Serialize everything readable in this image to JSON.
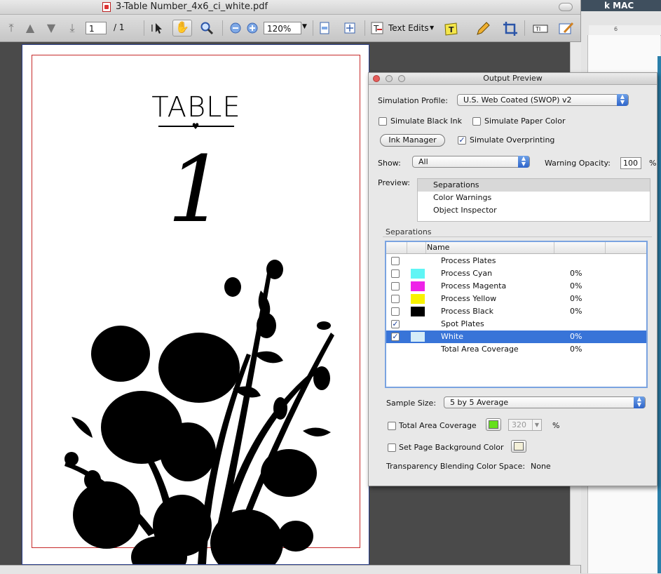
{
  "background_window": {
    "title": "k MAC",
    "ruler_mark": "6"
  },
  "document_window": {
    "title": "3-Table Number_4x6_ci_white.pdf",
    "toolbar": {
      "page_number": "1",
      "page_total": "/  1",
      "zoom": "120%",
      "text_edits_label": "Text Edits",
      "icons": [
        "first-page-icon",
        "prev-page-icon",
        "next-page-icon",
        "last-page-icon",
        "select-tool-icon",
        "hand-tool-icon",
        "zoom-tool-icon",
        "zoom-out-icon",
        "zoom-in-icon",
        "fit-width-icon",
        "full-screen-icon",
        "text-edits-icon",
        "sticky-note-icon",
        "pencil-icon",
        "crop-icon",
        "text-field-icon",
        "sign-icon"
      ]
    },
    "page": {
      "heading": "TABLE",
      "number": "1"
    }
  },
  "output_preview": {
    "title": "Output Preview",
    "simulation_profile_label": "Simulation Profile:",
    "simulation_profile_value": "U.S. Web Coated (SWOP) v2",
    "simulate_black_ink": {
      "label": "Simulate Black Ink",
      "checked": false
    },
    "simulate_paper_color": {
      "label": "Simulate Paper Color",
      "checked": false
    },
    "ink_manager_label": "Ink Manager",
    "simulate_overprinting": {
      "label": "Simulate Overprinting",
      "checked": true
    },
    "show_label": "Show:",
    "show_value": "All",
    "warning_opacity_label": "Warning Opacity:",
    "warning_opacity_value": "100",
    "warning_opacity_unit": "%",
    "preview_label": "Preview:",
    "preview_items": [
      "Separations",
      "Color Warnings",
      "Object Inspector"
    ],
    "separations_heading": "Separations",
    "separations_column_name": "Name",
    "separations": [
      {
        "name": "Process Plates",
        "percent": "",
        "swatch": "",
        "checked": false,
        "selected": false
      },
      {
        "name": "Process Cyan",
        "percent": "0%",
        "swatch": "#5ff5f5",
        "checked": false,
        "selected": false
      },
      {
        "name": "Process Magenta",
        "percent": "0%",
        "swatch": "#ee22e8",
        "checked": false,
        "selected": false
      },
      {
        "name": "Process Yellow",
        "percent": "0%",
        "swatch": "#f8f200",
        "checked": false,
        "selected": false
      },
      {
        "name": "Process Black",
        "percent": "0%",
        "swatch": "#000000",
        "checked": false,
        "selected": false
      },
      {
        "name": "Spot Plates",
        "percent": "",
        "swatch": "",
        "checked": true,
        "selected": false
      },
      {
        "name": "White",
        "percent": "0%",
        "swatch": "#d4ecf8",
        "checked": true,
        "selected": true
      },
      {
        "name": "Total Area Coverage",
        "percent": "0%",
        "swatch": "",
        "checked": false,
        "selected": false
      }
    ],
    "sample_size_label": "Sample Size:",
    "sample_size_value": "5 by 5 Average",
    "total_area_coverage": {
      "label": "Total Area Coverage",
      "checked": false,
      "color": "#66e01c",
      "value": "320",
      "unit": "%"
    },
    "set_page_background": {
      "label": "Set Page Background Color",
      "checked": false,
      "color": "#f4f0d8"
    },
    "transparency_label": "Transparency Blending Color Space:",
    "transparency_value": "None"
  }
}
